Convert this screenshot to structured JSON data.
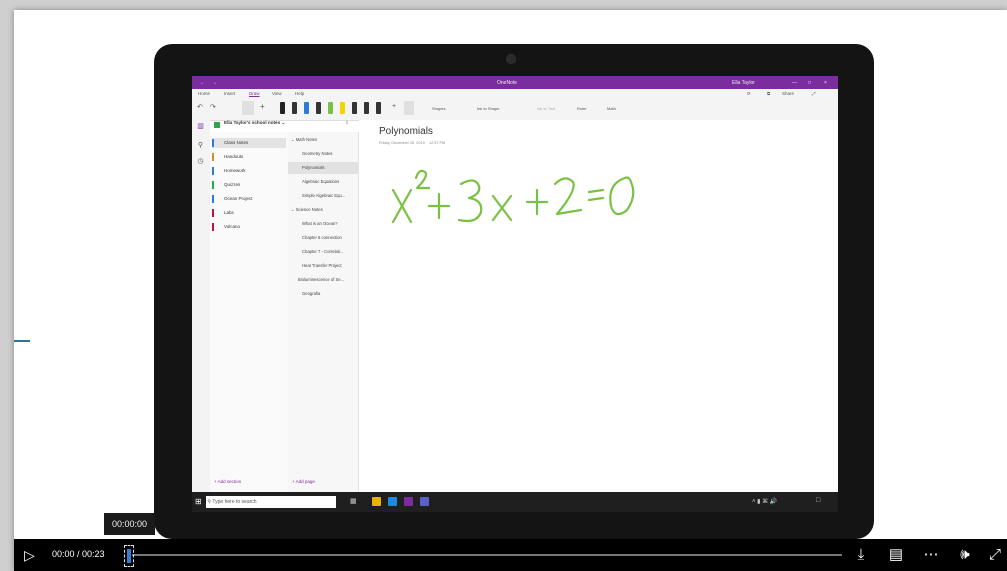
{
  "app": {
    "title": "OneNote",
    "user": "Ella Taylor",
    "menu": [
      "Home",
      "Insert",
      "Draw",
      "View",
      "Help"
    ],
    "ribbon": [
      "Shapes",
      "Ink to Shape",
      "Ink to Text",
      "Ruler",
      "Math"
    ],
    "share_label": "Share"
  },
  "notebook": {
    "name": "Ella Taylor's school notes",
    "sections": [
      {
        "label": "Class Notes",
        "color": "#2b7cd3"
      },
      {
        "label": "Handouts",
        "color": "#d98a2b"
      },
      {
        "label": "Homework",
        "color": "#2b7cd3"
      },
      {
        "label": "Quizzes",
        "color": "#2ea44f"
      },
      {
        "label": "Ocean Project",
        "color": "#2b7cd3"
      },
      {
        "label": "Labs",
        "color": "#c0143c"
      },
      {
        "label": "Volcano",
        "color": "#c0143c"
      }
    ],
    "pages": [
      "Math Notes",
      "Geometry Notes",
      "Polynomials",
      "Algebraic Equations",
      "Simple Algebraic Equ...",
      "Science Notes",
      "What is an Ocean?",
      "Chapter 6 connection",
      "Chapter 7 - Correlati...",
      "Heat Transfer Project",
      "Bioluminescence of Se...",
      "Geografia"
    ],
    "add_section": "Add section",
    "add_page": "Add page"
  },
  "page": {
    "title": "Polynomials",
    "date": "Friday, December 20, 2019",
    "time": "12:37 PM",
    "ink_color": "#7ac143"
  },
  "taskbar": {
    "search_placeholder": "Type here to search"
  },
  "player": {
    "tooltip_time": "00:00:00",
    "time_display": "00:00 / 00:23",
    "progress": 0
  },
  "icons": [
    "play-icon",
    "download-icon",
    "captions-icon",
    "more-icon",
    "volume-icon",
    "fullscreen-icon"
  ]
}
